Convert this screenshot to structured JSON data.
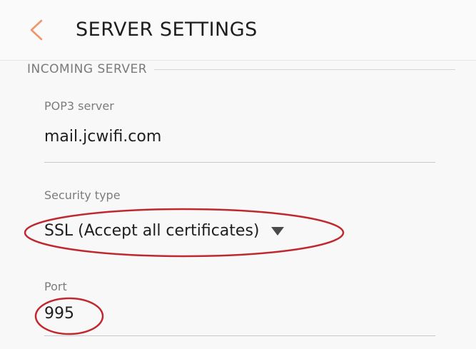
{
  "header": {
    "title": "SERVER SETTINGS",
    "back_icon": "chevron-left-icon",
    "accent_color": "#f0956a"
  },
  "section": {
    "title": "INCOMING SERVER"
  },
  "fields": {
    "server": {
      "label": "POP3 server",
      "value": "mail.jcwifi.com"
    },
    "security": {
      "label": "Security type",
      "value": "SSL (Accept all certificates)",
      "icon": "dropdown-triangle-icon"
    },
    "port": {
      "label": "Port",
      "value": "995"
    }
  },
  "annotation_color": "#c0282f"
}
